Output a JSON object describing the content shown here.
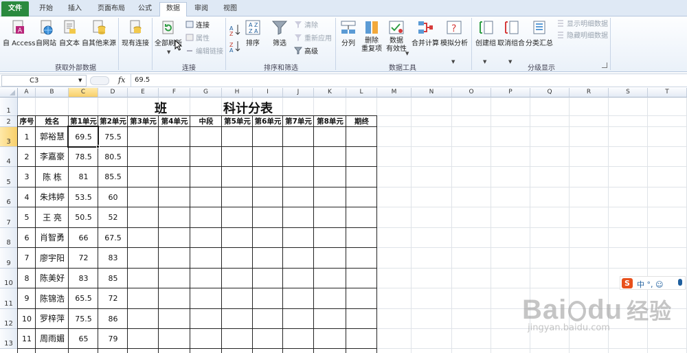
{
  "ribbon_tabs": [
    {
      "label": "文件",
      "x": 0
    },
    {
      "label": "开始"
    },
    {
      "label": "插入"
    },
    {
      "label": "页面布局"
    },
    {
      "label": "公式"
    },
    {
      "label": "数据"
    },
    {
      "label": "审阅"
    },
    {
      "label": "视图"
    }
  ],
  "ribbon": {
    "get_external": {
      "group": "获取外部数据",
      "access": "自 Access",
      "web": "自网站",
      "text": "自文本",
      "other": "自其他来源",
      "existing": "现有连接"
    },
    "connections": {
      "group": "连接",
      "refresh_all": "全部刷新",
      "connections": "连接",
      "properties": "属性",
      "edit_links": "编辑链接"
    },
    "sort_filter": {
      "group": "排序和筛选",
      "sort": "排序",
      "filter": "筛选",
      "clear": "清除",
      "reapply": "重新应用",
      "advanced": "高级"
    },
    "data_tools": {
      "group": "数据工具",
      "split": "分列",
      "remove_dup_1": "删除",
      "remove_dup_2": "重复项",
      "validation_1": "数据",
      "validation_2": "有效性",
      "consolidate": "合并计算",
      "whatif": "模拟分析"
    },
    "outline": {
      "group": "分级显示",
      "group_btn": "创建组",
      "ungroup": "取消组合",
      "subtotal": "分类汇总",
      "show_detail": "显示明细数据",
      "hide_detail": "隐藏明细数据"
    }
  },
  "formula_bar": {
    "name_box": "C3",
    "fx": "fx",
    "value": "69.5"
  },
  "columns": [
    "A",
    "B",
    "C",
    "D",
    "E",
    "F",
    "G",
    "H",
    "I",
    "J",
    "K",
    "L",
    "M",
    "N",
    "O",
    "P",
    "Q",
    "R",
    "S",
    "T"
  ],
  "rows": [
    "1",
    "2",
    "3",
    "4",
    "5",
    "6",
    "7",
    "8",
    "9",
    "10",
    "11",
    "12",
    "13"
  ],
  "sheet": {
    "title_left": "班",
    "title_right": "科计分表",
    "headers": [
      "序号",
      "姓名",
      "第1单元",
      "第2单元",
      "第3单元",
      "第4单元",
      "中段",
      "第5单元",
      "第6单元",
      "第7单元",
      "第8单元",
      "期终"
    ],
    "records": [
      {
        "no": "1",
        "name": "郭裕慧",
        "u1": "69.5",
        "u2": "75.5"
      },
      {
        "no": "2",
        "name": "李嘉豪",
        "u1": "78.5",
        "u2": "80.5"
      },
      {
        "no": "3",
        "name": "陈 栋",
        "u1": "81",
        "u2": "85.5"
      },
      {
        "no": "4",
        "name": "朱炜婷",
        "u1": "53.5",
        "u2": "60"
      },
      {
        "no": "5",
        "name": "王 亮",
        "u1": "50.5",
        "u2": "52"
      },
      {
        "no": "6",
        "name": "肖智勇",
        "u1": "66",
        "u2": "67.5"
      },
      {
        "no": "7",
        "name": "廖宇阳",
        "u1": "72",
        "u2": "83"
      },
      {
        "no": "8",
        "name": "陈美好",
        "u1": "83",
        "u2": "85"
      },
      {
        "no": "9",
        "name": "陈锦浩",
        "u1": "65.5",
        "u2": "72"
      },
      {
        "no": "10",
        "name": "罗梓萍",
        "u1": "75.5",
        "u2": "86"
      },
      {
        "no": "11",
        "name": "周雨媚",
        "u1": "65",
        "u2": "79"
      }
    ]
  },
  "ime_bar": {
    "text": "中 °, ☺"
  },
  "watermark": {
    "brand": "Bai",
    "brand2": "du",
    "cn": "经验",
    "url": "jingyan.baidu.com"
  },
  "colors": {
    "file_tab": "#2a8a3e",
    "accent": "#f8cf6a"
  }
}
